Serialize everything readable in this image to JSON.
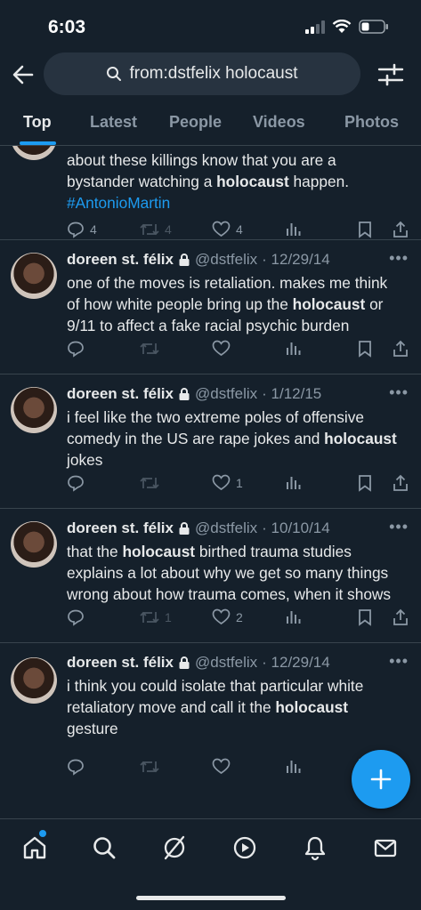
{
  "status_bar": {
    "time": "6:03"
  },
  "search": {
    "query": "from:dstfelix holocaust"
  },
  "tabs": [
    {
      "label": "Top",
      "active": true
    },
    {
      "label": "Latest",
      "active": false
    },
    {
      "label": "People",
      "active": false
    },
    {
      "label": "Videos",
      "active": false
    },
    {
      "label": "Photos",
      "active": false
    }
  ],
  "tweets": [
    {
      "text_line1": "about these killings know that you are a",
      "text_line2_before": "bystander watching a ",
      "text_line2_bold": "holocaust",
      "text_line2_after": " happen.",
      "hashtag": "#AntonioMartin",
      "replies": "4",
      "retweets": "4",
      "likes": "4"
    },
    {
      "name": "doreen st. félix",
      "handle": "@dstfelix",
      "date": "· 12/29/14",
      "line1": "one of the moves is retaliation. makes me think",
      "line2_before": "of how white people bring up the ",
      "line2_bold": "holocaust",
      "line2_after": " or",
      "line3": "9/11 to affect a fake racial psychic burden",
      "replies": "",
      "retweets": "",
      "likes": ""
    },
    {
      "name": "doreen st. félix",
      "handle": "@dstfelix",
      "date": "· 1/12/15",
      "line1": "i feel like the two extreme poles of offensive",
      "line2_before": "comedy in the US are rape jokes and ",
      "line2_bold": "holocaust",
      "line2_after": "",
      "line3": "jokes",
      "replies": "",
      "retweets": "",
      "likes": "1"
    },
    {
      "name": "doreen st. félix",
      "handle": "@dstfelix",
      "date": "· 10/10/14",
      "line1_before": "that the ",
      "line1_bold": "holocaust",
      "line1_after": " birthed trauma studies",
      "line2": "explains a lot about why we get so many things",
      "line3": "wrong about how trauma comes, when it shows",
      "replies": "",
      "retweets": "1",
      "likes": "2"
    },
    {
      "name": "doreen st. félix",
      "handle": "@dstfelix",
      "date": "· 12/29/14",
      "line1": "i think you could isolate that particular white",
      "line2_before": "retaliatory move and call it the ",
      "line2_bold": "holocaust",
      "line3": "gesture",
      "replies": "",
      "retweets": "",
      "likes": ""
    }
  ],
  "icons": {
    "back": "arrow-left-icon",
    "search": "search-icon",
    "filter": "sliders-icon",
    "reply": "reply-icon",
    "retweet": "retweet-icon",
    "like": "heart-icon",
    "views": "views-icon",
    "bookmark": "bookmark-icon",
    "share": "share-icon",
    "compose": "plus-icon"
  },
  "colors": {
    "background": "#15202b",
    "accent": "#1d9bf0",
    "text": "#e7e9ea",
    "muted": "#8b98a5",
    "divider": "#38444d"
  }
}
